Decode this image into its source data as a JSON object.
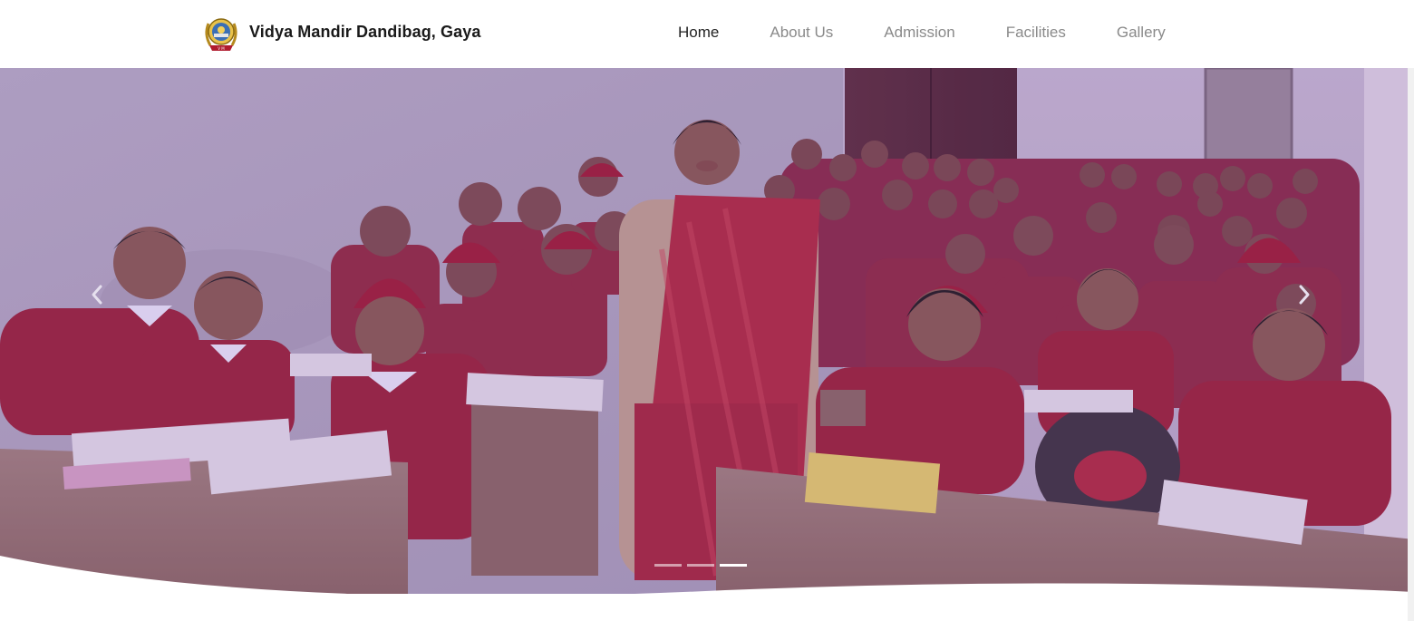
{
  "header": {
    "brand_name": "Vidya Mandir Dandibag, Gaya",
    "logo_icon": "school-crest-icon"
  },
  "nav": {
    "items": [
      {
        "label": "Home",
        "active": true
      },
      {
        "label": "About Us",
        "active": false
      },
      {
        "label": "Admission",
        "active": false
      },
      {
        "label": "Facilities",
        "active": false
      },
      {
        "label": "Gallery",
        "active": false
      }
    ]
  },
  "slider": {
    "image_description_icon": "classroom-photo",
    "prev_icon": "chevron-left-icon",
    "next_icon": "chevron-right-icon",
    "slide_count": 3,
    "active_slide": 3
  },
  "colors": {
    "nav_active": "#222222",
    "nav_inactive": "#8a8a8a",
    "uniform_red": "#8e1b2c",
    "overlay_purple": "#7a3ca0"
  }
}
